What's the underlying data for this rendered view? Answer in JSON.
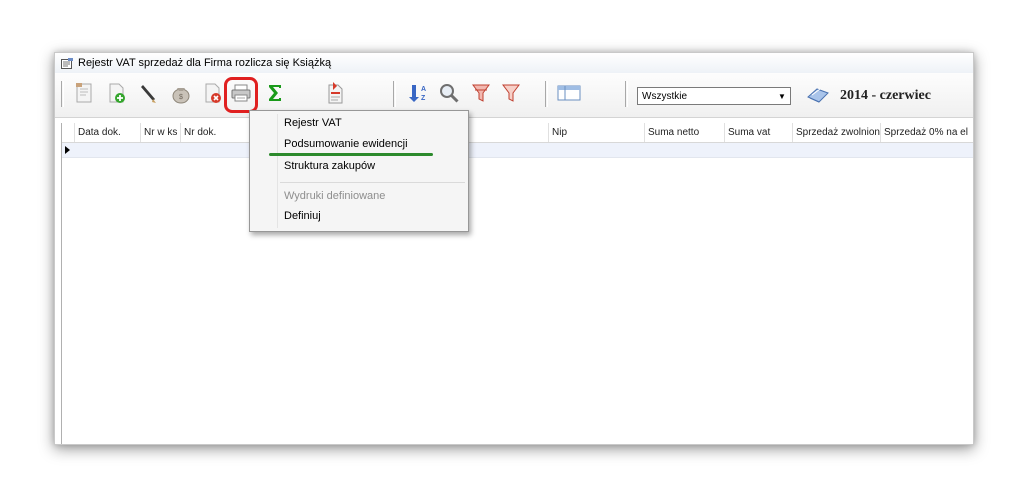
{
  "window": {
    "title": "Rejestr VAT sprzedaż  dla Firma rozlicza się Książką"
  },
  "toolbar": {
    "buttons": [
      {
        "name": "edit-document-icon"
      },
      {
        "name": "add-document-icon"
      },
      {
        "name": "edit-pen-icon"
      },
      {
        "name": "money-bag-icon"
      },
      {
        "name": "delete-document-icon"
      },
      {
        "name": "printer-icon"
      },
      {
        "name": "sigma-sum-icon"
      },
      {
        "name": "export-document-icon"
      },
      {
        "name": "sort-az-icon"
      },
      {
        "name": "magnifier-icon"
      },
      {
        "name": "filter-icon"
      },
      {
        "name": "filter-clear-icon"
      },
      {
        "name": "columns-icon"
      }
    ],
    "filter_value": "Wszystkie",
    "period_label": "2014 - czerwiec"
  },
  "grid": {
    "columns": [
      "Data dok.",
      "Nr w ks",
      "Nr dok.",
      "Nip",
      "Suma netto",
      "Suma vat",
      "Sprzedaż zwolnion",
      "Sprzedaż 0% na el"
    ]
  },
  "print_menu": {
    "items": [
      {
        "label": "Rejestr VAT",
        "enabled": true
      },
      {
        "label": "Podsumowanie ewidencji",
        "enabled": true
      },
      {
        "label": "Struktura zakupów",
        "enabled": true
      },
      {
        "label": "Wydruki definiowane",
        "enabled": false
      },
      {
        "label": "Definiuj",
        "enabled": true
      }
    ]
  },
  "colors": {
    "highlight_red": "#e02020",
    "annotation_green": "#2c8a2c",
    "sigma_green": "#1a9a1a"
  }
}
